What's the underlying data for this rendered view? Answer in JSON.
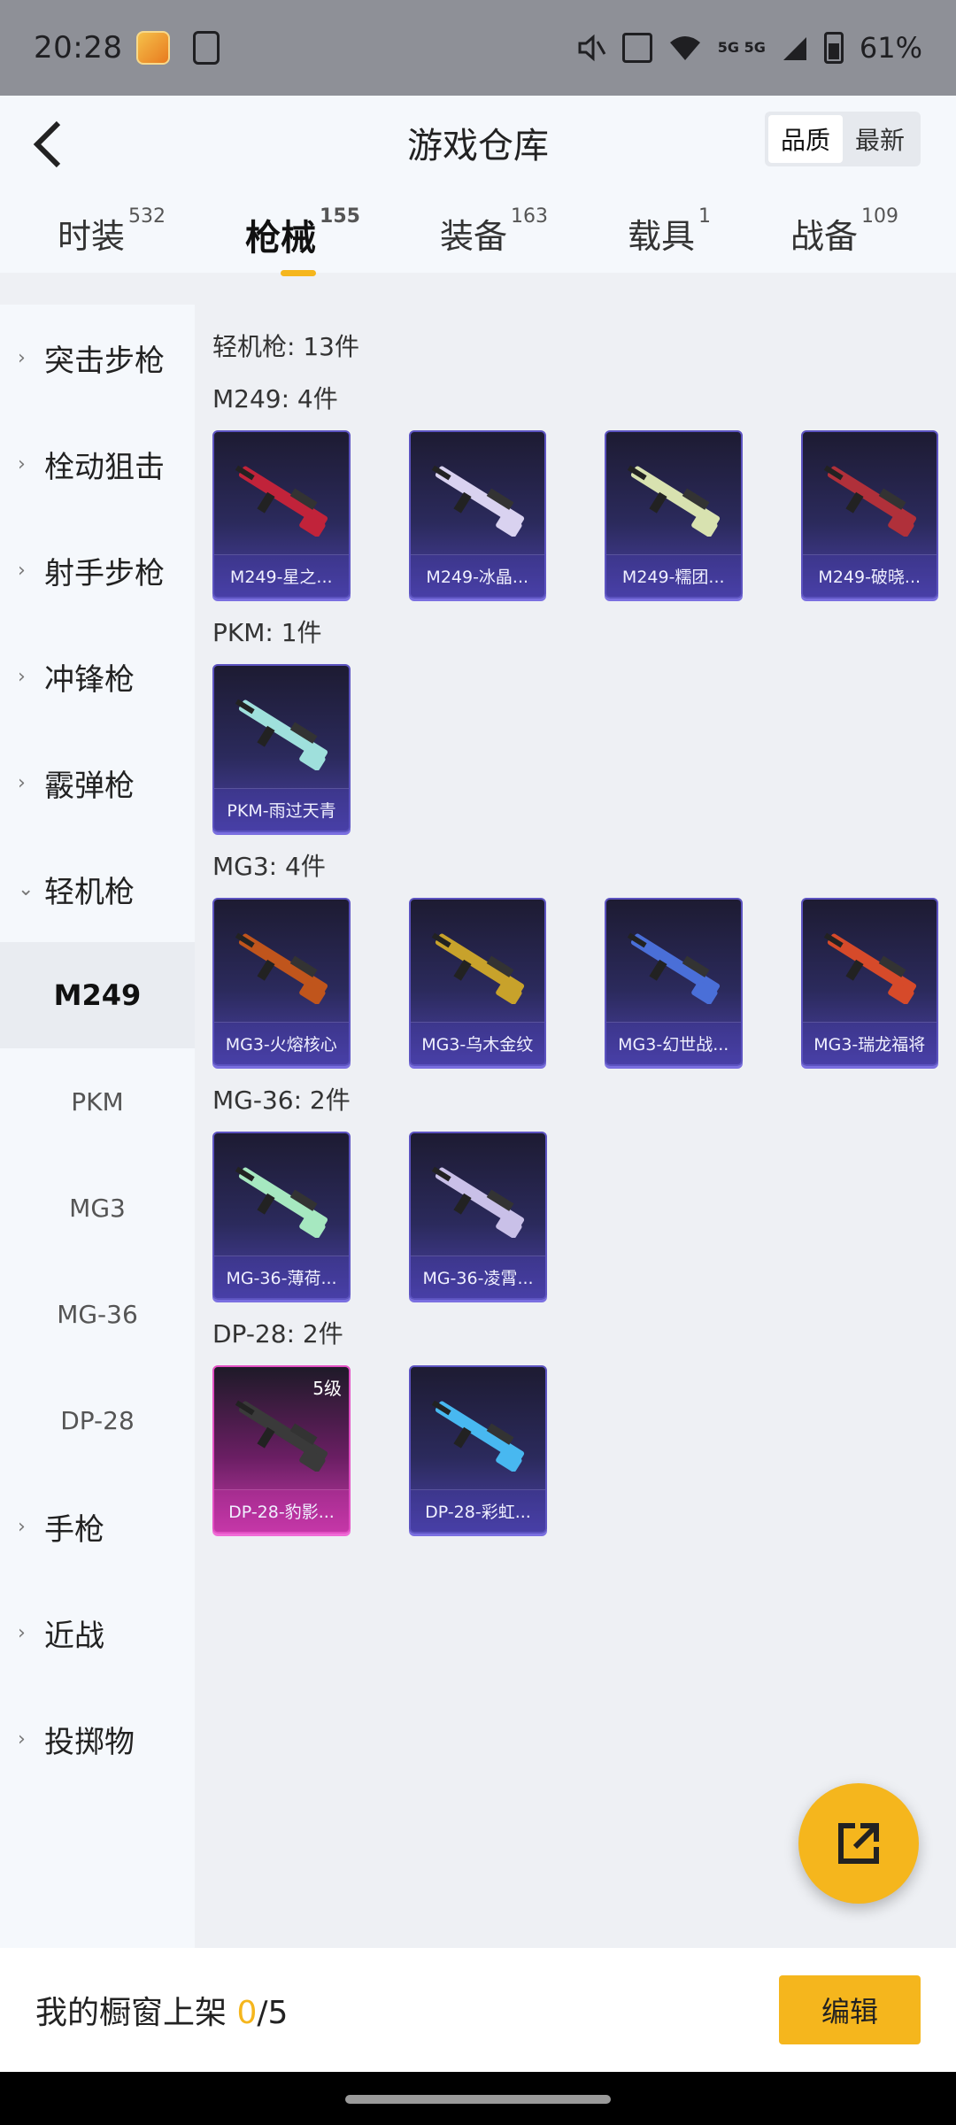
{
  "status_bar": {
    "time": "20:28",
    "battery": "61%",
    "network": "5G 5G",
    "icons": [
      "app-icon",
      "phone-icon",
      "mute-icon",
      "nfc-icon",
      "wifi-icon",
      "signal-icon",
      "battery-icon"
    ]
  },
  "header": {
    "title": "游戏仓库",
    "back_icon": "chevron-left-icon",
    "sort": {
      "quality": "品质",
      "latest": "最新",
      "active": "quality"
    }
  },
  "tabs": [
    {
      "label": "时装",
      "count": "532"
    },
    {
      "label": "枪械",
      "count": "155",
      "active": true
    },
    {
      "label": "装备",
      "count": "163"
    },
    {
      "label": "载具",
      "count": "1"
    },
    {
      "label": "战备",
      "count": "109"
    }
  ],
  "sidebar": {
    "items": [
      {
        "label": "突击步枪"
      },
      {
        "label": "栓动狙击"
      },
      {
        "label": "射手步枪"
      },
      {
        "label": "冲锋枪"
      },
      {
        "label": "霰弹枪"
      },
      {
        "label": "轻机枪",
        "expanded": true
      }
    ],
    "sub_items": [
      {
        "label": "M249",
        "active": true
      },
      {
        "label": "PKM"
      },
      {
        "label": "MG3"
      },
      {
        "label": "MG-36"
      },
      {
        "label": "DP-28"
      }
    ],
    "items_after": [
      {
        "label": "手枪"
      },
      {
        "label": "近战"
      },
      {
        "label": "投掷物"
      }
    ]
  },
  "content": {
    "section_title": "轻机枪: 13件",
    "groups": [
      {
        "title": "M249: 4件",
        "items": [
          {
            "label": "M249-星之...",
            "gun_color": "#c1233a"
          },
          {
            "label": "M249-冰晶...",
            "gun_color": "#d9d2f0"
          },
          {
            "label": "M249-糯团...",
            "gun_color": "#d8e2b0"
          },
          {
            "label": "M249-破晓...",
            "gun_color": "#b0303a"
          }
        ]
      },
      {
        "title": "PKM: 1件",
        "items": [
          {
            "label": "PKM-雨过天青",
            "gun_color": "#9fe0dc"
          }
        ]
      },
      {
        "title": "MG3: 4件",
        "items": [
          {
            "label": "MG3-火熔核心",
            "gun_color": "#c0551c"
          },
          {
            "label": "MG3-乌木金纹",
            "gun_color": "#c8a22b"
          },
          {
            "label": "MG3-幻世战...",
            "gun_color": "#4a6fd8"
          },
          {
            "label": "MG3-瑞龙福将",
            "gun_color": "#d64a2a"
          }
        ]
      },
      {
        "title": "MG-36: 2件",
        "items": [
          {
            "label": "MG-36-薄荷...",
            "gun_color": "#a6e8c0"
          },
          {
            "label": "MG-36-凌霄...",
            "gun_color": "#c9c0e8"
          }
        ]
      },
      {
        "title": "DP-28: 2件",
        "items": [
          {
            "label": "DP-28-豹影...",
            "gun_color": "#3a3a3a",
            "level": "5级",
            "pink": true
          },
          {
            "label": "DP-28-彩虹...",
            "gun_color": "#48b8f0"
          }
        ]
      }
    ]
  },
  "fab": {
    "icon": "share-external-icon"
  },
  "bottom": {
    "showcase_label": "我的橱窗上架",
    "showcase_current": "0",
    "showcase_total": "/5",
    "edit_label": "编辑"
  },
  "colors": {
    "accent": "#f5b61d",
    "card_purple": "#4a41a6",
    "card_pink": "#c43ba8"
  }
}
